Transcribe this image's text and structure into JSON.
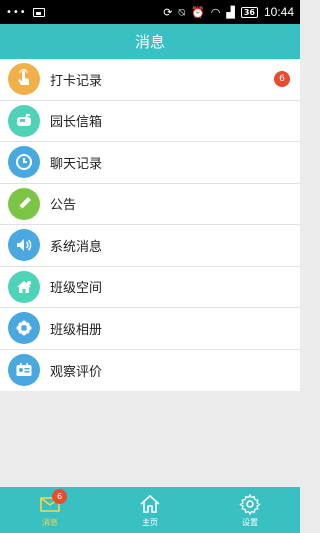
{
  "status_bar": {
    "battery": "36",
    "time": "10:44"
  },
  "header": {
    "title": "消息"
  },
  "colors": {
    "accent": "#39c0c3",
    "badge": "#e94b2d",
    "active_tab": "#f2d64b"
  },
  "menu": {
    "items": [
      {
        "label": "打卡记录",
        "icon": "finger-tap-icon",
        "badge": "6"
      },
      {
        "label": "园长信箱",
        "icon": "mailbox-icon"
      },
      {
        "label": "聊天记录",
        "icon": "clock-history-icon"
      },
      {
        "label": "公告",
        "icon": "pencil-icon"
      },
      {
        "label": "系统消息",
        "icon": "speaker-icon"
      },
      {
        "label": "班级空间",
        "icon": "house-icon"
      },
      {
        "label": "班级相册",
        "icon": "flower-icon"
      },
      {
        "label": "观察评价",
        "icon": "id-card-icon"
      }
    ]
  },
  "tabs": [
    {
      "label": "消息",
      "icon": "envelope-icon",
      "badge": "6",
      "active": true
    },
    {
      "label": "主页",
      "icon": "home-icon"
    },
    {
      "label": "设置",
      "icon": "gear-icon"
    }
  ]
}
